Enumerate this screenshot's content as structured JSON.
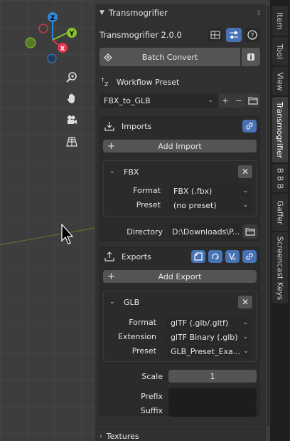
{
  "gizmo": {
    "z": "Z",
    "y": "Y",
    "x": "X"
  },
  "panel": {
    "title": "Transmogrifier",
    "version": "Transmogrifier 2.0.0",
    "batch_convert": "Batch Convert",
    "workflow_label": "Workflow Preset",
    "workflow_value": "FBX_to_GLB",
    "imports": {
      "title": "Imports",
      "add_label": "Add Import",
      "item_title": "FBX",
      "format_label": "Format",
      "format_value": "FBX (.fbx)",
      "preset_label": "Preset",
      "preset_value": "(no preset)",
      "directory_label": "Directory",
      "directory_value": "D:\\Downloads\\P..."
    },
    "exports": {
      "title": "Exports",
      "add_label": "Add Export",
      "item_title": "GLB",
      "format_label": "Format",
      "format_value": "glTF (.glb/.gltf)",
      "extension_label": "Extension",
      "extension_value": "glTF Binary (.glb)",
      "preset_label": "Preset",
      "preset_value": "GLB_Preset_Exa...",
      "scale_label": "Scale",
      "scale_value": "1",
      "prefix_label": "Prefix",
      "prefix_value": "",
      "suffix_label": "Suffix",
      "suffix_value": ""
    },
    "textures_title": "Textures"
  },
  "tabs": [
    "Item",
    "Tool",
    "View",
    "Transmogrifier",
    "B B B",
    "Gaffer",
    "Screencast Keys"
  ],
  "colors": {
    "accent_blue": "#4772b3",
    "x_red": "#e0344f",
    "y_green": "#8bc22c",
    "z_blue": "#2f87d6"
  },
  "icons": [
    "zoom-icon",
    "hand-icon",
    "camera-icon",
    "grid-icon",
    "cursor-icon",
    "info-icon",
    "link-icon",
    "folder-icon"
  ]
}
